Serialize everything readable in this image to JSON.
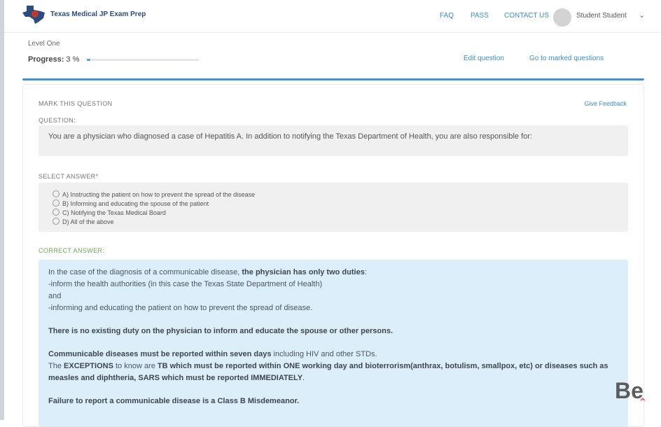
{
  "header": {
    "brand": "Texas Medical JP Exam Prep",
    "nav": [
      "FAQ",
      "PASS",
      "CONTACT US"
    ],
    "user_name": "Student Student"
  },
  "level": {
    "label": "Level One"
  },
  "progress": {
    "label": "Progress:",
    "value": "3 %",
    "fraction": 0.03
  },
  "actions": {
    "edit": "Edit question",
    "goto": "Go to marked questions"
  },
  "card": {
    "mark_title": "MARK THIS QUESTION",
    "feedback": "Give Feedback",
    "question_label": "QUESTION:",
    "question_text": "You are a physician who diagnosed a case of Hepatitis A. In addition to notifying the Texas Department of Health, you are also responsible for:",
    "select_label": "SELECT ANSWER",
    "required_mark": "*",
    "choices": [
      "A) Instructing the patient on how to prevent the spread of the disease",
      "B) Informing and educating the spouse of the patient",
      "C) Notifying the Texas Medical Board",
      "D) All of the above"
    ],
    "correct_label": "CORRECT ANSWER:",
    "answer": {
      "p1_pre": "In the case of the diagnosis of a communicable disease, ",
      "p1_bold": "the physician has only two duties",
      "p1_post": ":",
      "l2": "-inform the health authorities (in this case the Texas State Department of Health)",
      "l3": "and",
      "l4": "-informing and educating the patient on how to prevent the spread of disease.",
      "p2": "There is no existing duty on the physician to inform and educate the spouse or other persons.",
      "p3_bold": "Communicable diseases must be reported within seven days",
      "p3_post": " including HIV and other STDs.",
      "p4_pre": "The ",
      "p4_b1": "EXCEPTIONS",
      "p4_mid": " to know are ",
      "p4_b2": "TB which must be reported within ONE working day and bioterrorism(anthrax, botulism, smallpox, etc) or diseases such as measles and diphtheria, SARS which must be reported IMMEDIATELY",
      "p4_end": ".",
      "p5_bold": "Failure to report a communicable disease is a Class B Misdemeanor."
    }
  },
  "colors": {
    "accent": "#3b95d6",
    "answer_bg": "#dbeef9",
    "correct": "#6aaa4f"
  }
}
